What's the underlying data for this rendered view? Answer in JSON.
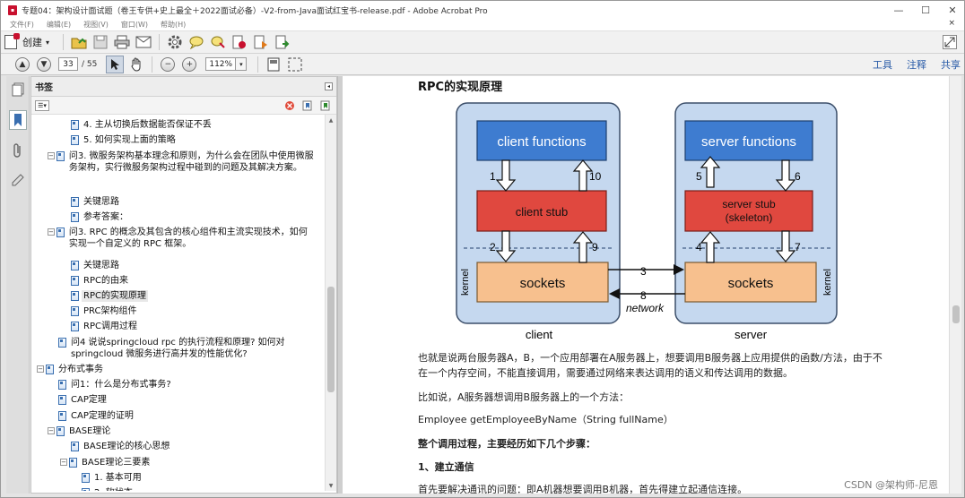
{
  "window": {
    "title": "专题04：架构设计面试题（卷王专供+史上最全＋2022面试必备）-V2-from-Java面试红宝书-release.pdf - Adobe Acrobat Pro",
    "min": "—",
    "max": "☐",
    "close": "✕"
  },
  "menu": {
    "items": [
      "文件(F)",
      "编辑(E)",
      "视图(V)",
      "窗口(W)",
      "帮助(H)"
    ],
    "close": "×"
  },
  "toolbar": {
    "create_label": "创建",
    "create_caret": "▾"
  },
  "nav": {
    "page_current": "33",
    "page_total": "/ 55",
    "zoom": "112%",
    "zoom_caret": "▾",
    "minus": "−",
    "plus": "+",
    "links": [
      "工具",
      "注释",
      "共享"
    ]
  },
  "bookmarks": {
    "title": "书签",
    "pin": "◂",
    "options": "☰▾",
    "items": [
      {
        "text": "4. 主从切换后数据能否保证不丢",
        "indent": 3,
        "toggle": ""
      },
      {
        "text": "5. 如何实现上面的策略",
        "indent": 3,
        "toggle": ""
      },
      {
        "text": "问3. 微服务架构基本理念和原则，为什么会在团队中使用微服务架构，实行微服务架构过程中碰到的问题及其解决方案。",
        "indent": 2,
        "toggle": "−"
      },
      {
        "text": "关键思路",
        "indent": 3,
        "toggle": ""
      },
      {
        "text": "参考答案：",
        "indent": 3,
        "toggle": ""
      },
      {
        "text": "问3. RPC 的概念及其包含的核心组件和主流实现技术，如何实现一个自定义的 RPC 框架。",
        "indent": 2,
        "toggle": "−"
      },
      {
        "text": "关键思路",
        "indent": 3,
        "toggle": ""
      },
      {
        "text": "RPC的由来",
        "indent": 3,
        "toggle": ""
      },
      {
        "text": "RPC的实现原理",
        "indent": 3,
        "toggle": "",
        "selected": true
      },
      {
        "text": "PRC架构组件",
        "indent": 3,
        "toggle": ""
      },
      {
        "text": "RPC调用过程",
        "indent": 3,
        "toggle": ""
      },
      {
        "text": "问4 说说springcloud rpc 的执行流程和原理? 如何对springcloud 微服务进行高并发的性能优化?",
        "indent": 2,
        "toggle": ""
      },
      {
        "text": "分布式事务",
        "indent": 1,
        "toggle": "−"
      },
      {
        "text": "问1：什么是分布式事务?",
        "indent": 2,
        "toggle": ""
      },
      {
        "text": "CAP定理",
        "indent": 2,
        "toggle": ""
      },
      {
        "text": "CAP定理的证明",
        "indent": 2,
        "toggle": ""
      },
      {
        "text": "BASE理论",
        "indent": 2,
        "toggle": "−"
      },
      {
        "text": "BASE理论的核心思想",
        "indent": 3,
        "toggle": ""
      },
      {
        "text": "BASE理论三要素",
        "indent": 3,
        "toggle": "−"
      },
      {
        "text": "1. 基本可用",
        "indent": 4,
        "toggle": ""
      },
      {
        "text": "2. 软状态",
        "indent": 4,
        "toggle": ""
      }
    ]
  },
  "document": {
    "heading": "RPC的实现原理",
    "diagram": {
      "client_functions": "client functions",
      "client_stub": "client stub",
      "client_sockets": "sockets",
      "server_functions": "server functions",
      "server_stub_line1": "server stub",
      "server_stub_line2": "(skeleton)",
      "server_sockets": "sockets",
      "kernel_left": "kernel",
      "kernel_right": "kernel",
      "client_label": "client",
      "server_label": "server",
      "network_label": "network",
      "steps": [
        "1",
        "2",
        "3",
        "4",
        "5",
        "6",
        "7",
        "8",
        "9",
        "10"
      ],
      "colors": {
        "function_box": "#3e7cd0",
        "stub_box": "#e0483f",
        "socket_box": "#f7c08e",
        "panel": "#c5d8ef"
      }
    },
    "para1": "也就是说两台服务器A，B，一个应用部署在A服务器上，想要调用B服务器上应用提供的函数/方法，由于不在一个内存空间，不能直接调用，需要通过网络来表达调用的语义和传达调用的数据。",
    "para2": "比如说，A服务器想调用B服务器上的一个方法：",
    "para3": "Employee getEmployeeByName（String fullName）",
    "para4": "整个调用过程，主要经历如下几个步骤：",
    "para5": "1、建立通信",
    "para6": "首先要解决通讯的问题：即A机器想要调用B机器，首先得建立起通信连接。"
  },
  "watermark": "CSDN @架构师-尼恩"
}
